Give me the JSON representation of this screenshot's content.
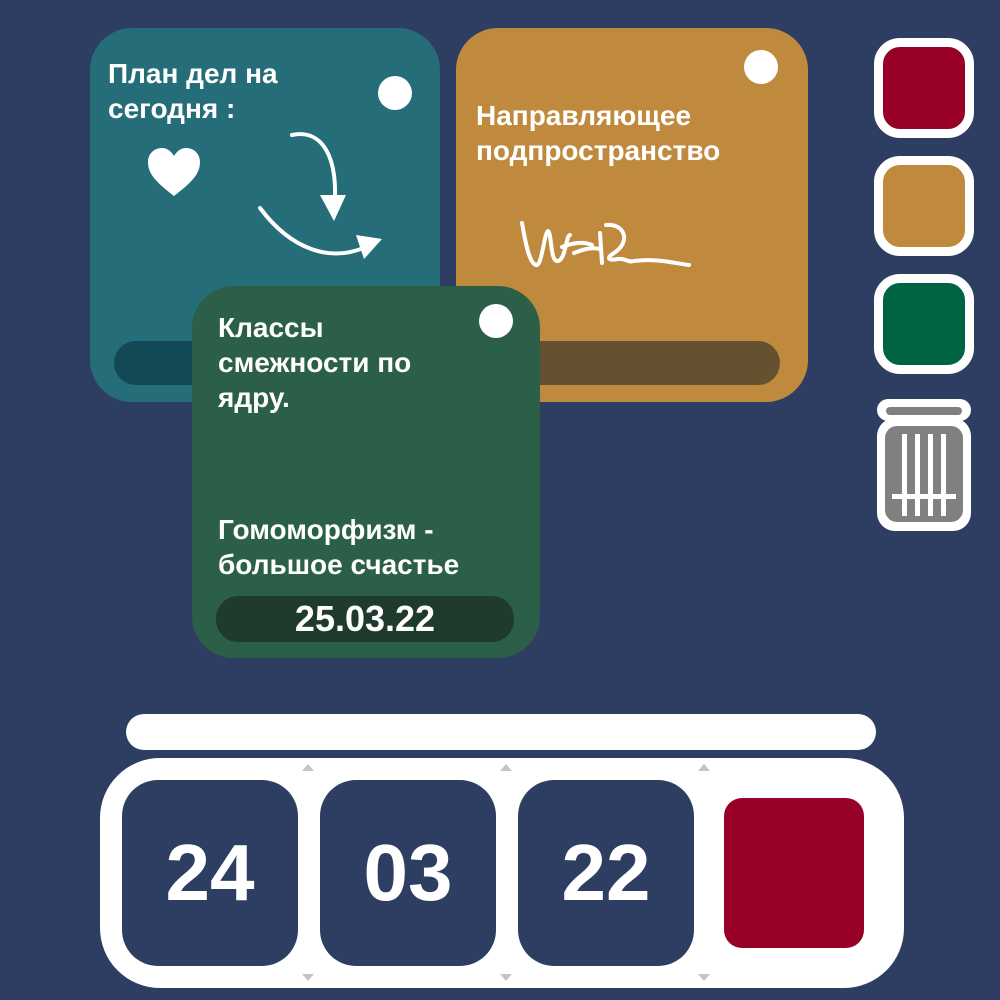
{
  "notes": {
    "teal": {
      "title_line1": "План дел на",
      "title_line2": "сегодня :",
      "color": "#256d78",
      "icons": [
        "heart-icon",
        "curved-arrow-down-icon",
        "curved-arrow-right-icon"
      ]
    },
    "orange": {
      "title_line1": "Направляющее",
      "title_line2": "подпространство",
      "color": "#c08a3e",
      "icons": [
        "signature"
      ]
    },
    "green": {
      "title_line1": "Классы",
      "title_line2": "смежности по",
      "title_line3": "ядру.",
      "body_line1": "Гомоморфизм -",
      "body_line2": "большое счастье",
      "date": "25.03.22",
      "color": "#2b5f47"
    }
  },
  "palette": {
    "colors": [
      "#990027",
      "#c08a3e",
      "#006343"
    ],
    "icons": [
      "trash-icon"
    ]
  },
  "date_picker": {
    "day": "24",
    "month": "03",
    "year": "22",
    "selected_color": "#990027"
  },
  "theme": {
    "background": "#2e3e63"
  }
}
